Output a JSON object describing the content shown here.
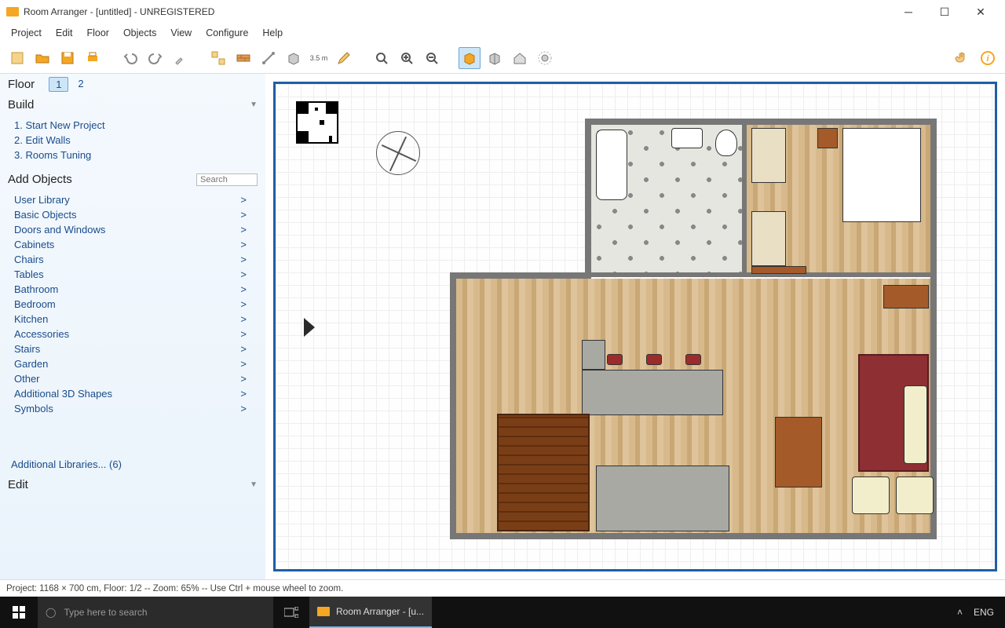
{
  "titlebar": {
    "title": "Room Arranger - [untitled] - UNREGISTERED"
  },
  "menubar": {
    "items": [
      "Project",
      "Edit",
      "Floor",
      "Objects",
      "View",
      "Configure",
      "Help"
    ]
  },
  "toolbar": {
    "icons": [
      "new",
      "open",
      "save",
      "print",
      "undo",
      "redo",
      "brush",
      "group",
      "wall",
      "connect",
      "box3d",
      "measure",
      "pencil",
      "zoom-fit",
      "zoom-in",
      "zoom-out",
      "view-3d",
      "view-iso",
      "home",
      "gears"
    ],
    "right_icons": [
      "hand",
      "info"
    ],
    "measure_label": "3.5 m"
  },
  "sidebar": {
    "floor_label": "Floor",
    "floors": [
      "1",
      "2"
    ],
    "selected_floor": 0,
    "build": {
      "title": "Build",
      "items": [
        "1. Start New Project",
        "2. Edit Walls",
        "3. Rooms Tuning"
      ]
    },
    "add_objects": {
      "title": "Add Objects",
      "search_placeholder": "Search",
      "categories": [
        "User Library",
        "Basic Objects",
        "Doors and Windows",
        "Cabinets",
        "Chairs",
        "Tables",
        "Bathroom",
        "Bedroom",
        "Kitchen",
        "Accessories",
        "Stairs",
        "Garden",
        "Other",
        "Additional 3D Shapes",
        "Symbols"
      ]
    },
    "additional_libraries": "Additional Libraries... (6)",
    "edit": {
      "title": "Edit"
    }
  },
  "statusbar": {
    "text": "Project: 1168 × 700 cm, Floor: 1/2 -- Zoom: 65% -- Use Ctrl + mouse wheel to zoom."
  },
  "taskbar": {
    "search_placeholder": "Type here to search",
    "open_app": "Room Arranger - [u...",
    "lang": "ENG",
    "chevron": "˄"
  }
}
